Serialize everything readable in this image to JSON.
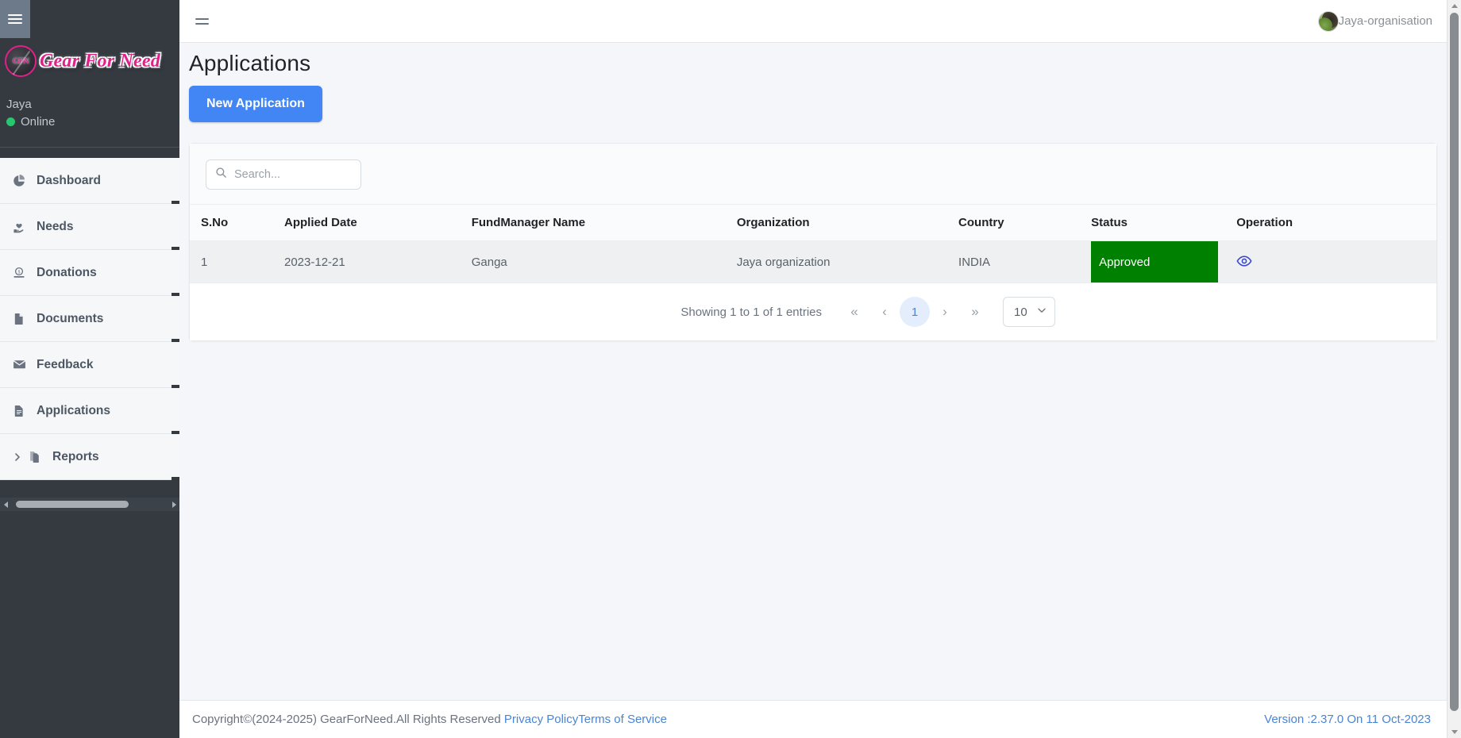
{
  "sidebar": {
    "hamburger_icon": "hamburger-icon",
    "brand": {
      "emblem_text": "GFN",
      "name": "Gear For Need"
    },
    "user": {
      "name": "Jaya",
      "status": "Online"
    },
    "items": [
      {
        "label": "Dashboard",
        "icon": "pie-chart-icon",
        "has_caret": false
      },
      {
        "label": "Needs",
        "icon": "hand-heart-icon",
        "has_caret": false
      },
      {
        "label": "Donations",
        "icon": "money-icon",
        "has_caret": false
      },
      {
        "label": "Documents",
        "icon": "file-icon",
        "has_caret": false
      },
      {
        "label": "Feedback",
        "icon": "envelope-icon",
        "has_caret": false
      },
      {
        "label": "Applications",
        "icon": "document-icon",
        "has_caret": false
      },
      {
        "label": "Reports",
        "icon": "copy-files-icon",
        "has_caret": true
      }
    ]
  },
  "topbar": {
    "menu_icon": "hamburger-icon",
    "user_label": "Jaya-organisation",
    "avatar_icon": "avatar"
  },
  "page": {
    "title": "Applications"
  },
  "toolbar": {
    "new_application_label": "New Application"
  },
  "search": {
    "placeholder": "Search...",
    "value": "",
    "icon": "search-icon"
  },
  "table": {
    "columns": [
      "S.No",
      "Applied Date",
      "FundManager Name",
      "Organization",
      "Country",
      "Status",
      "Operation"
    ],
    "rows": [
      {
        "sno": "1",
        "applied_date": "2023-12-21",
        "fundmanager_name": "Ganga",
        "organization": "Jaya organization",
        "country": "INDIA",
        "status": "Approved",
        "operation_icon": "eye-icon"
      }
    ]
  },
  "pagination": {
    "info": "Showing 1 to 1 of 1 entries",
    "first_label": "«",
    "prev_label": "‹",
    "current_page": "1",
    "next_label": "›",
    "last_label": "»",
    "page_size": "10",
    "chevron_icon": "chevron-down-icon"
  },
  "footer": {
    "copyright": "Copyright©(2024-2025) GearForNeed.All Rights Reserved ",
    "privacy_policy": "Privacy Policy",
    "terms_of_service": "Terms of Service",
    "version": "Version :2.37.0 On 11 Oct-2023"
  },
  "colors": {
    "sidebar_bg": "#343a40",
    "brand_pink": "#e0218a",
    "primary_blue": "#4285f4",
    "status_green": "#008000",
    "link_blue": "#4a84d6",
    "online_green": "#28c76f"
  }
}
